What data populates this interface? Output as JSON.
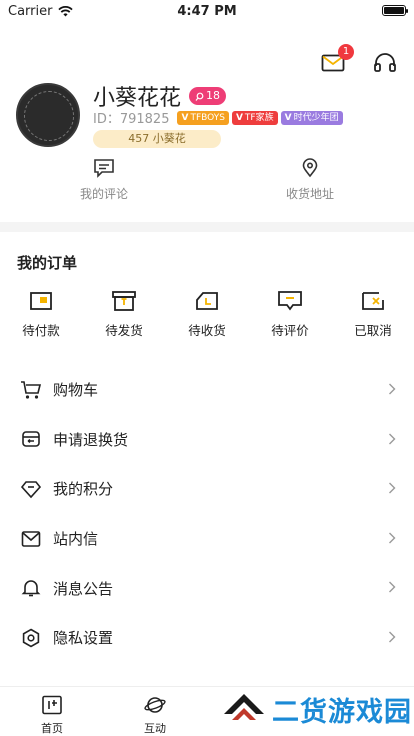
{
  "status_bar": {
    "carrier": "Carrier",
    "time": "4:47 PM"
  },
  "header": {
    "mail_badge": "1"
  },
  "profile": {
    "name": "小葵花花",
    "level": "18",
    "id_text": "ID：791825",
    "tags": [
      {
        "label": "TFBOYS",
        "color": "#f5a020"
      },
      {
        "label": "TF家族",
        "color": "#ee3d3d"
      },
      {
        "label": "时代少年团",
        "color": "#9a7be0"
      }
    ],
    "score": "457 小葵花"
  },
  "quick_links": [
    {
      "label": "我的评论",
      "icon": "comment-icon"
    },
    {
      "label": "收货地址",
      "icon": "location-icon"
    }
  ],
  "orders": {
    "title": "我的订单",
    "items": [
      {
        "label": "待付款",
        "icon": "pending-payment-icon"
      },
      {
        "label": "待发货",
        "icon": "pending-shipment-icon"
      },
      {
        "label": "待收货",
        "icon": "pending-receipt-icon"
      },
      {
        "label": "待评价",
        "icon": "pending-review-icon"
      },
      {
        "label": "已取消",
        "icon": "cancelled-icon"
      }
    ]
  },
  "menu": [
    {
      "label": "购物车",
      "icon": "cart-icon"
    },
    {
      "label": "申请退换货",
      "icon": "return-icon"
    },
    {
      "label": "我的积分",
      "icon": "diamond-icon"
    },
    {
      "label": "站内信",
      "icon": "mail-icon"
    },
    {
      "label": "消息公告",
      "icon": "bell-icon"
    },
    {
      "label": "隐私设置",
      "icon": "gear-icon"
    }
  ],
  "tabbar": [
    {
      "label": "首页",
      "icon": "home-icon"
    },
    {
      "label": "互动",
      "icon": "planet-icon"
    }
  ],
  "watermark": {
    "text": "二货游戏园"
  }
}
